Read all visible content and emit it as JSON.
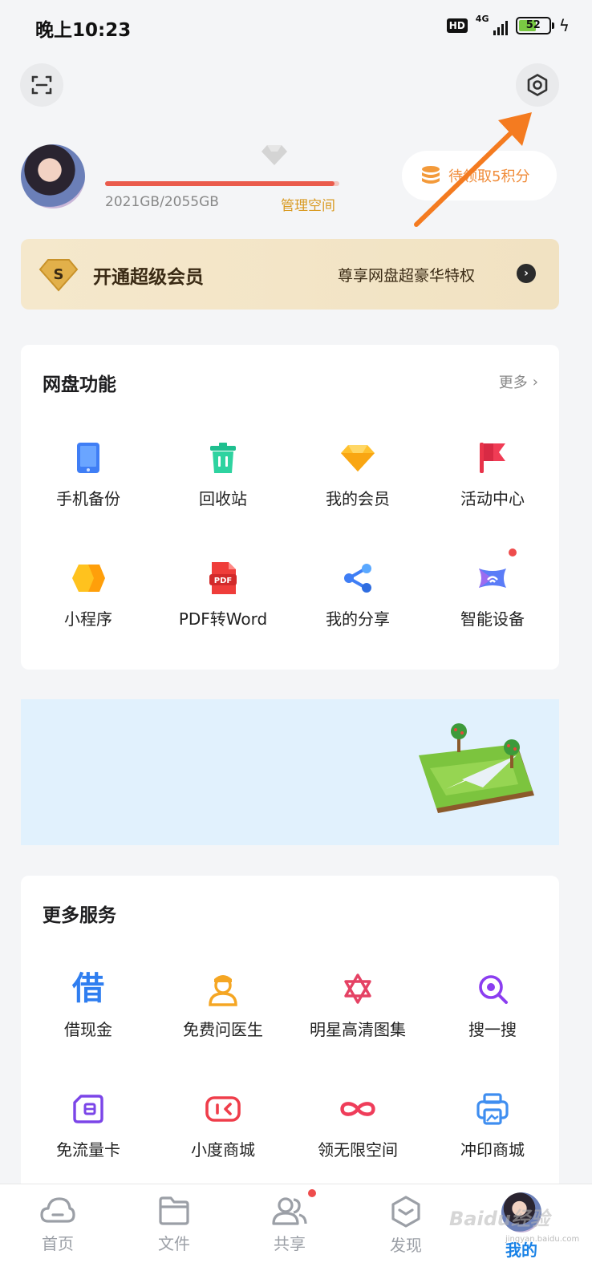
{
  "status_bar": {
    "time": "晚上10:23",
    "hd": "HD",
    "network": "4G",
    "battery_level": "52"
  },
  "profile": {
    "storage_text": "2021GB/2055GB",
    "storage_used_fraction": 0.98,
    "manage_label": "管理空间",
    "points_label": "待领取5积分"
  },
  "vip_banner": {
    "title": "开通超级会员",
    "subtitle": "尊享网盘超豪华特权"
  },
  "features": {
    "title": "网盘功能",
    "more_label": "更多",
    "items": [
      {
        "label": "手机备份",
        "icon": "phone-backup-icon"
      },
      {
        "label": "回收站",
        "icon": "recycle-bin-icon"
      },
      {
        "label": "我的会员",
        "icon": "gem-icon"
      },
      {
        "label": "活动中心",
        "icon": "flag-icon"
      },
      {
        "label": "小程序",
        "icon": "mini-program-icon"
      },
      {
        "label": "PDF转Word",
        "icon": "pdf-icon"
      },
      {
        "label": "我的分享",
        "icon": "share-icon"
      },
      {
        "label": "智能设备",
        "icon": "smart-device-icon"
      }
    ],
    "pdf_badge": "PDF"
  },
  "services": {
    "title": "更多服务",
    "items": [
      {
        "label": "借现金",
        "icon": "loan-icon",
        "glyph": "借"
      },
      {
        "label": "免费问医生",
        "icon": "doctor-icon"
      },
      {
        "label": "明星高清图集",
        "icon": "star-gallery-icon"
      },
      {
        "label": "搜一搜",
        "icon": "search-icon"
      },
      {
        "label": "免流量卡",
        "icon": "sim-card-icon"
      },
      {
        "label": "小度商城",
        "icon": "xiaodu-mall-icon"
      },
      {
        "label": "领无限空间",
        "icon": "infinity-icon"
      },
      {
        "label": "冲印商城",
        "icon": "print-icon"
      }
    ]
  },
  "bottom_nav": {
    "items": [
      {
        "label": "首页",
        "icon": "cloud-home-icon"
      },
      {
        "label": "文件",
        "icon": "folder-icon"
      },
      {
        "label": "共享",
        "icon": "people-icon"
      },
      {
        "label": "发现",
        "icon": "discover-icon"
      },
      {
        "label": "我的",
        "icon": "avatar"
      }
    ],
    "active_index": 4
  },
  "watermark": {
    "text": "Baidu经验",
    "sub": "jingyan.baidu.com"
  },
  "colors": {
    "accent_blue": "#1a82e6",
    "storage_red": "#ea5b4c",
    "gold": "#d99a22",
    "annotation_orange": "#f47b20"
  }
}
